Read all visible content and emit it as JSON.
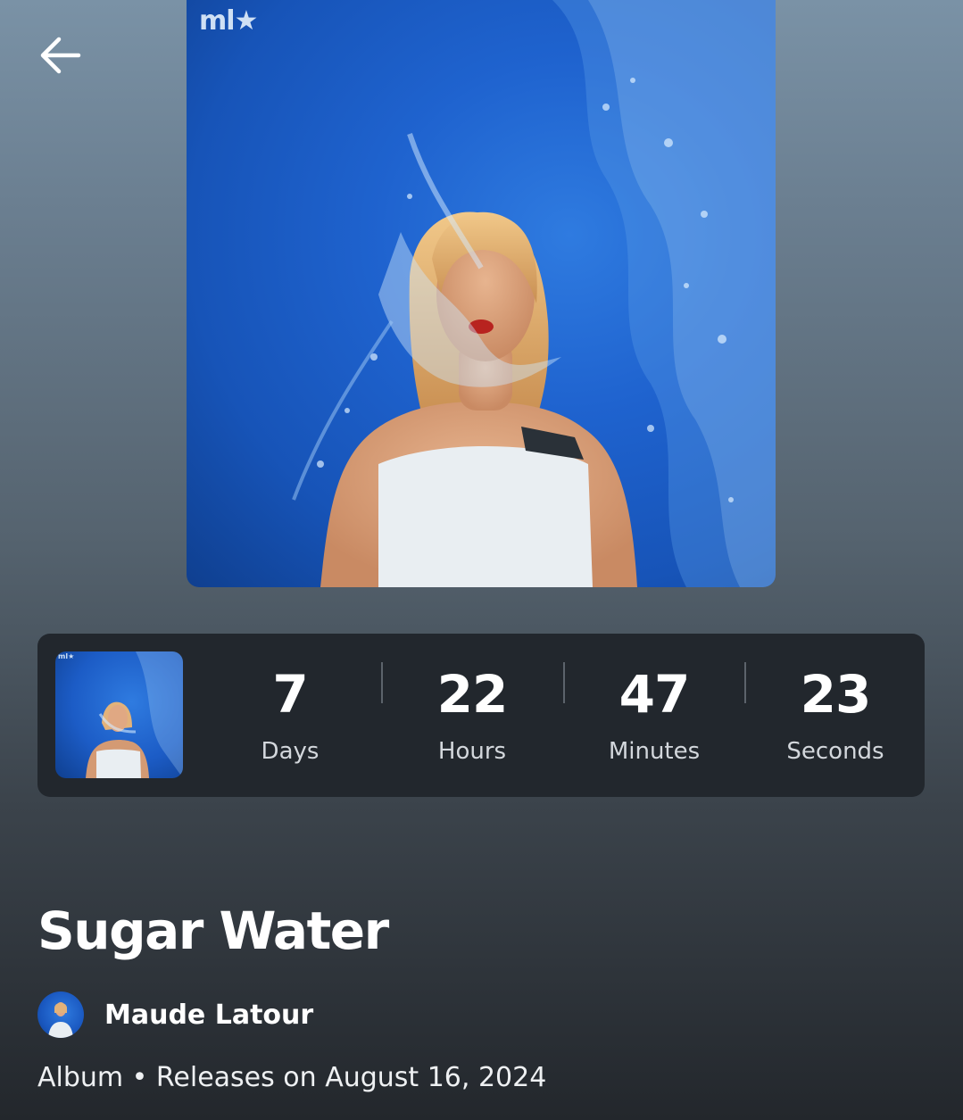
{
  "header": {
    "back_icon": "arrow-left-icon"
  },
  "cover": {
    "logo_text": "ml★"
  },
  "countdown": {
    "units": [
      {
        "value": "7",
        "label": "Days"
      },
      {
        "value": "22",
        "label": "Hours"
      },
      {
        "value": "47",
        "label": "Minutes"
      },
      {
        "value": "23",
        "label": "Seconds"
      }
    ]
  },
  "release": {
    "title": "Sugar Water",
    "artist": "Maude Latour",
    "meta": "Album • Releases on August 16, 2024"
  },
  "colors": {
    "card_background": "#22272d",
    "cover_blue": "#1f63cf",
    "text_primary": "#ffffff"
  }
}
